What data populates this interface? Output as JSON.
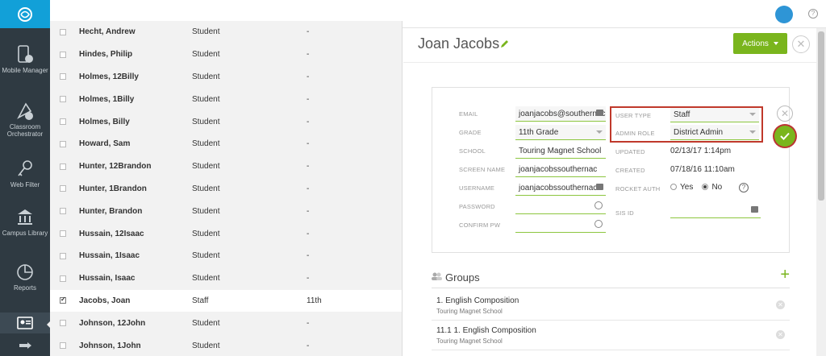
{
  "nav": {
    "items": [
      {
        "label": "Mobile Manager",
        "icon": "mobile-manager-icon"
      },
      {
        "label": "Classroom Orchestrator",
        "icon": "classroom-orchestrator-icon"
      },
      {
        "label": "Web Filter",
        "icon": "key-icon"
      },
      {
        "label": "Campus Library",
        "icon": "library-icon"
      },
      {
        "label": "Reports",
        "icon": "pie-chart-icon"
      }
    ]
  },
  "list": {
    "rows": [
      {
        "name": "Hecht, Andrew",
        "role": "Student",
        "grade": "-",
        "checked": false
      },
      {
        "name": "Hindes, Philip",
        "role": "Student",
        "grade": "-",
        "checked": false
      },
      {
        "name": "Holmes, 12Billy",
        "role": "Student",
        "grade": "-",
        "checked": false
      },
      {
        "name": "Holmes, 1Billy",
        "role": "Student",
        "grade": "-",
        "checked": false
      },
      {
        "name": "Holmes, Billy",
        "role": "Student",
        "grade": "-",
        "checked": false
      },
      {
        "name": "Howard, Sam",
        "role": "Student",
        "grade": "-",
        "checked": false
      },
      {
        "name": "Hunter, 12Brandon",
        "role": "Student",
        "grade": "-",
        "checked": false
      },
      {
        "name": "Hunter, 1Brandon",
        "role": "Student",
        "grade": "-",
        "checked": false
      },
      {
        "name": "Hunter, Brandon",
        "role": "Student",
        "grade": "-",
        "checked": false
      },
      {
        "name": "Hussain, 12Isaac",
        "role": "Student",
        "grade": "-",
        "checked": false
      },
      {
        "name": "Hussain, 1Isaac",
        "role": "Student",
        "grade": "-",
        "checked": false
      },
      {
        "name": "Hussain, Isaac",
        "role": "Student",
        "grade": "-",
        "checked": false
      },
      {
        "name": "Jacobs, Joan",
        "role": "Staff",
        "grade": "11th",
        "checked": true
      },
      {
        "name": "Johnson, 12John",
        "role": "Student",
        "grade": "-",
        "checked": false
      },
      {
        "name": "Johnson, 1John",
        "role": "Student",
        "grade": "-",
        "checked": false
      }
    ]
  },
  "detail": {
    "name": "Joan Jacobs",
    "actions_label": "Actions",
    "close_glyph": "✕",
    "fields": {
      "email_label": "EMAIL",
      "email_value": "joanjacobs@southernac",
      "grade_label": "GRADE",
      "grade_value": "11th Grade",
      "school_label": "SCHOOL",
      "school_value": "Touring Magnet School",
      "screen_name_label": "SCREEN NAME",
      "screen_name_value": "joanjacobssouthernac",
      "username_label": "USERNAME",
      "username_value": "joanjacobssouthernac",
      "password_label": "PASSWORD",
      "confirm_pw_label": "CONFIRM PW",
      "user_type_label": "USER TYPE",
      "user_type_value": "Staff",
      "admin_role_label": "ADMIN ROLE",
      "admin_role_value": "District Admin",
      "updated_label": "UPDATED",
      "updated_value": "02/13/17 1:14pm",
      "created_label": "CREATED",
      "created_value": "07/18/16 11:10am",
      "rocket_auth_label": "ROCKET AUTH",
      "rocket_yes": "Yes",
      "rocket_no": "No",
      "rocket_selected": "No",
      "sis_id_label": "SIS ID",
      "help_glyph": "?"
    },
    "groups_title": "Groups",
    "add_glyph": "+",
    "groups": [
      {
        "name": "1. English Composition",
        "school": "Touring Magnet School"
      },
      {
        "name": "11.1 1. English Composition",
        "school": "Touring Magnet School"
      }
    ]
  },
  "colors": {
    "accent": "#7ab51d",
    "brand": "#12a0d8",
    "nav_bg": "#2f3a42",
    "highlight": "#c0392b"
  }
}
